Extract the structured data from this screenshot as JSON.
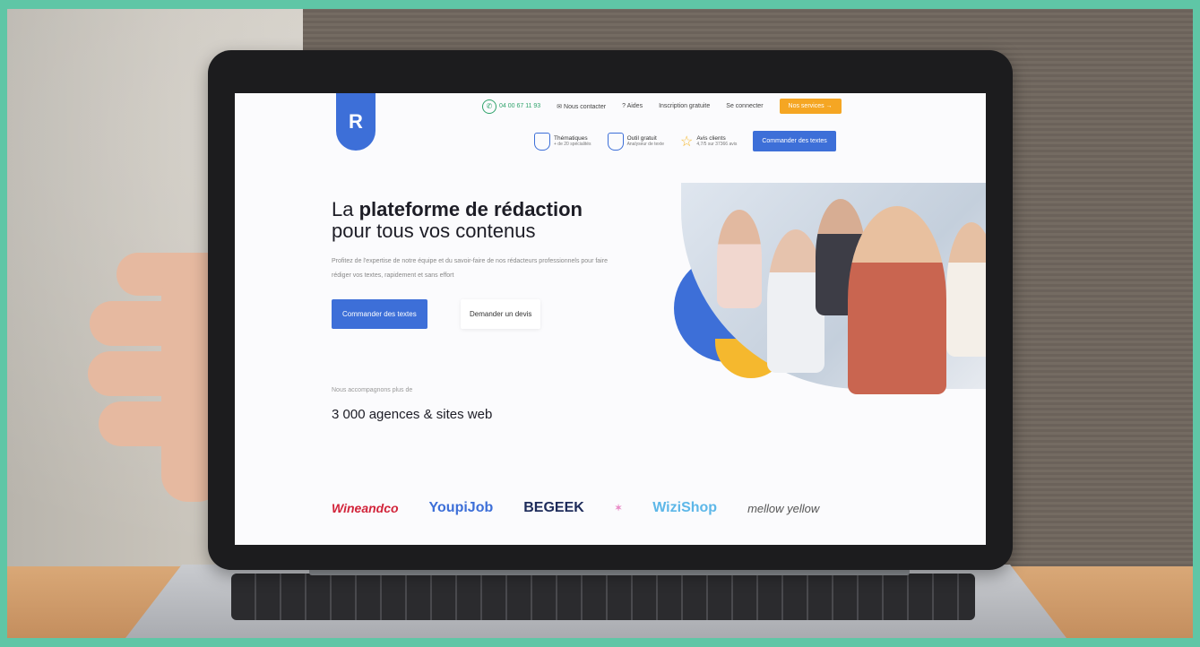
{
  "site": {
    "logo_letter": "R",
    "topnav": {
      "phone": "04 00 67 11 93",
      "contact": "Nous contacter",
      "help": "Aides",
      "signup": "Inscription gratuite",
      "login": "Se connecter",
      "services": "Nos services →"
    },
    "features": [
      {
        "title": "Thématiques",
        "sub": "+ de 20 spécialités"
      },
      {
        "title": "Outil gratuit",
        "sub": "Analyseur de texte"
      },
      {
        "title": "Avis clients",
        "sub": "4,7/5 sur 37366 avis"
      }
    ],
    "cta_top": "Commander des textes",
    "hero": {
      "title_pre": "La ",
      "title_bold": "plateforme de rédaction",
      "title_line2": "pour tous vos contenus",
      "text": "Profitez de l'expertise de notre équipe et du savoir-faire de nos rédacteurs professionnels pour faire rédiger vos textes, rapidement et sans effort",
      "primary_button": "Commander des textes",
      "secondary_button": "Demander un devis"
    },
    "intro": "Nous accompagnons plus de",
    "count": "3 000 agences & sites web",
    "client_logos": [
      "Wineandco",
      "YoupiJob",
      "BEGEEK",
      "",
      "WiziShop",
      "mellow yellow"
    ]
  },
  "colors": {
    "brand_blue": "#3d6fd8",
    "accent_orange": "#f5a623",
    "frame_green": "#5fc6a6"
  }
}
